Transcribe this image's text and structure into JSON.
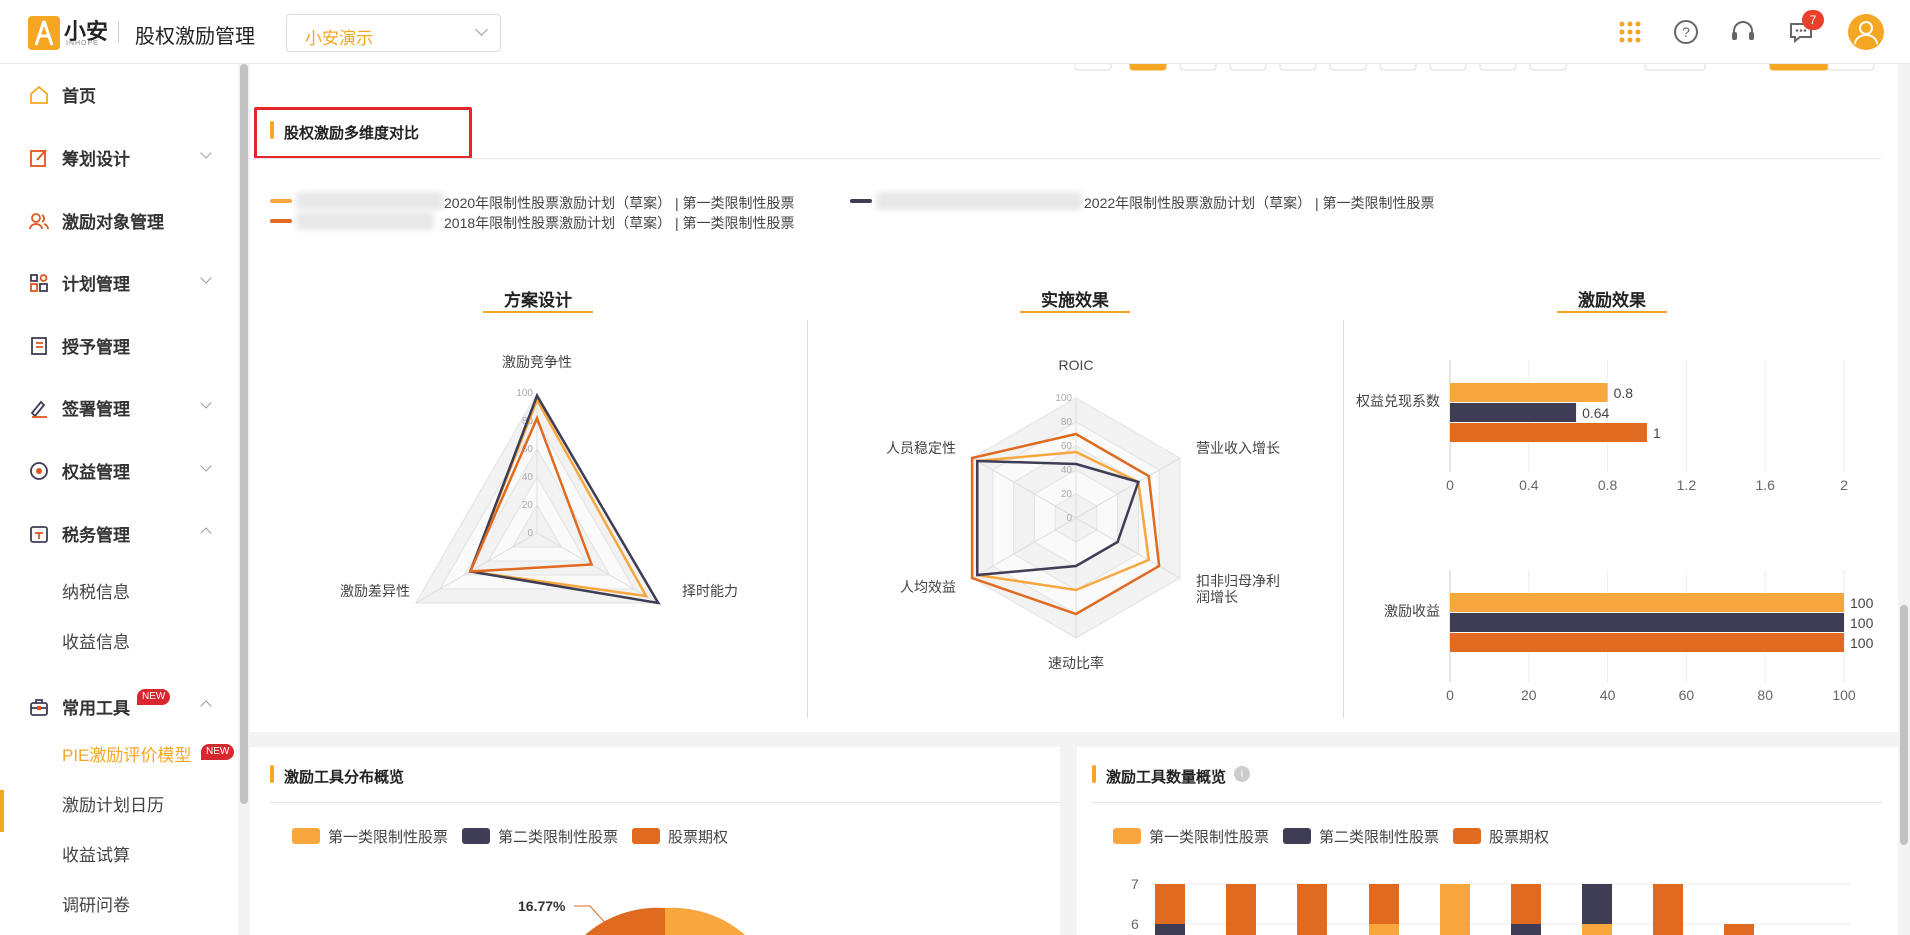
{
  "header": {
    "logo_text": "小安",
    "logo_sub": "INHOPE",
    "app_title": "股权激励管理",
    "company_select": "小安演示",
    "notification_count": "7",
    "icons": [
      "apps-grid-icon",
      "help-icon",
      "headset-icon",
      "message-icon",
      "user-avatar-icon"
    ]
  },
  "sidebar": {
    "items": [
      {
        "label": "首页",
        "icon": "home-icon"
      },
      {
        "label": "筹划设计",
        "icon": "edit-icon"
      },
      {
        "label": "激励对象管理",
        "icon": "users-icon"
      },
      {
        "label": "计划管理",
        "icon": "grid-icon"
      },
      {
        "label": "授予管理",
        "icon": "book-icon"
      },
      {
        "label": "签署管理",
        "icon": "sign-icon"
      },
      {
        "label": "权益管理",
        "icon": "badge-icon"
      },
      {
        "label": "税务管理",
        "icon": "tax-icon"
      },
      {
        "label": "常用工具",
        "icon": "toolbox-icon"
      }
    ],
    "tax_sub": [
      "纳税信息",
      "收益信息"
    ],
    "tools_sub": [
      "PIE激励评价模型",
      "激励计划日历",
      "收益试算",
      "调研问卷"
    ],
    "new_tag": "NEW"
  },
  "main": {
    "section_title": "股权激励多维度对比",
    "legend": [
      {
        "text": "2020年限制性股票激励计划（草案） | 第一类限制性股票",
        "color": "#f7a73d"
      },
      {
        "text": "2018年限制性股票激励计划（草案） | 第一类限制性股票",
        "color": "#e06a1f"
      },
      {
        "text": "2022年限制性股票激励计划（草案） | 第一类限制性股票",
        "color": "#3f3d56"
      }
    ],
    "charts": {
      "radar1_title": "方案设计",
      "radar2_title": "实施效果",
      "bars_title": "激励效果"
    }
  },
  "chart_data": [
    {
      "type": "radar",
      "title": "方案设计",
      "axes": [
        "激励竞争性",
        "择时能力",
        "激励差异性"
      ],
      "ticks": [
        "0",
        "20",
        "40",
        "60",
        "80",
        "100"
      ],
      "series": [
        {
          "color": "#f7a73d",
          "values": [
            95,
            90,
            55
          ]
        },
        {
          "color": "#3f3d56",
          "values": [
            98,
            100,
            55
          ]
        },
        {
          "color": "#e06a1f",
          "values": [
            82,
            45,
            55
          ]
        }
      ]
    },
    {
      "type": "radar",
      "title": "实施效果",
      "axes": [
        "ROIC",
        "营业收入增长",
        "扣非归母净利润增长",
        "速动比率",
        "人均效益",
        "人员稳定性"
      ],
      "axis_labels": [
        "ROIC",
        "营业收入增长",
        "扣非归母净利\n润增长",
        "速动比率",
        "人均效益",
        "人员稳定性"
      ],
      "ticks": [
        "0",
        "20",
        "40",
        "60",
        "80",
        "100"
      ],
      "series": [
        {
          "color": "#f7a73d",
          "values": [
            55,
            60,
            70,
            60,
            95,
            95
          ]
        },
        {
          "color": "#3f3d56",
          "values": [
            45,
            60,
            40,
            40,
            95,
            95
          ]
        },
        {
          "color": "#e06a1f",
          "values": [
            70,
            70,
            80,
            80,
            100,
            100
          ]
        }
      ]
    },
    {
      "type": "bar",
      "title": "激励效果",
      "orientation": "horizontal",
      "groups": [
        {
          "category": "权益兑现系数",
          "values": [
            0.8,
            0.64,
            1
          ],
          "labels": [
            "0.8",
            "0.64",
            "1"
          ],
          "xticks": [
            "0",
            "0.4",
            "0.8",
            "1.2",
            "1.6",
            "2"
          ],
          "xlim": [
            0,
            2
          ]
        },
        {
          "category": "激励收益",
          "values": [
            100,
            100,
            100
          ],
          "labels": [
            "100",
            "100",
            "100"
          ],
          "xticks": [
            "0",
            "20",
            "40",
            "60",
            "80",
            "100"
          ],
          "xlim": [
            0,
            100
          ]
        }
      ],
      "colors": [
        "#f7a73d",
        "#3f3d56",
        "#e06a1f"
      ]
    }
  ],
  "lower": {
    "left_title": "激励工具分布概览",
    "right_title": "激励工具数量概览",
    "legend": [
      "第一类限制性股票",
      "第二类限制性股票",
      "股票期权"
    ],
    "pie_label": "16.77%",
    "bar_yticks": [
      "7",
      "6"
    ]
  }
}
